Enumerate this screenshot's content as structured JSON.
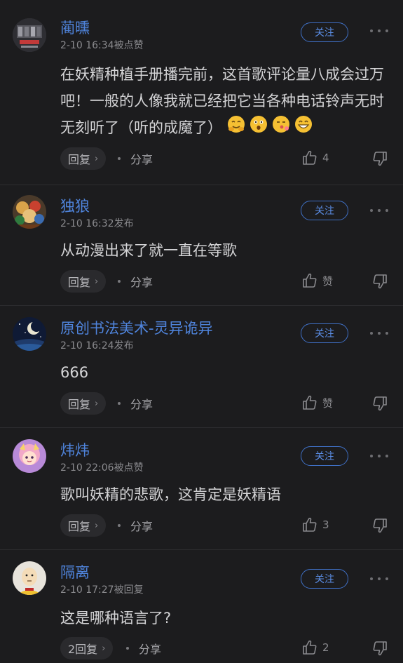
{
  "follow_label": "关注",
  "comments": [
    {
      "username": "蔺曛",
      "meta": "2-10 16:34被点赞",
      "text": "在妖精种植手册播完前，这首歌评论量八成会过万吧！一般的人像我就已经把它当各种电话铃声无时无刻听了（听的成魔了）",
      "emojis": [
        "smile-hands-emoji",
        "surprised-emoji",
        "kissing-emoji",
        "grinning-emoji"
      ],
      "reply_label": "回复",
      "share_label": "分享",
      "like_count": "4"
    },
    {
      "username": "独狼",
      "meta": "2-10 16:32发布",
      "text": "从动漫出来了就一直在等歌",
      "reply_label": "回复",
      "share_label": "分享",
      "like_count": "赞"
    },
    {
      "username": "原创书法美术-灵异诡异",
      "meta": "2-10 16:24发布",
      "text": "666",
      "reply_label": "回复",
      "share_label": "分享",
      "like_count": "赞"
    },
    {
      "username": "炜炜",
      "meta": "2-10 22:06被点赞",
      "text": "歌叫妖精的悲歌，这肯定是妖精语",
      "reply_label": "回复",
      "share_label": "分享",
      "like_count": "3"
    },
    {
      "username": "隔离",
      "meta": "2-10 17:27被回复",
      "text": "这是哪种语言了?",
      "reply_label": "2回复",
      "share_label": "分享",
      "like_count": "2"
    }
  ]
}
